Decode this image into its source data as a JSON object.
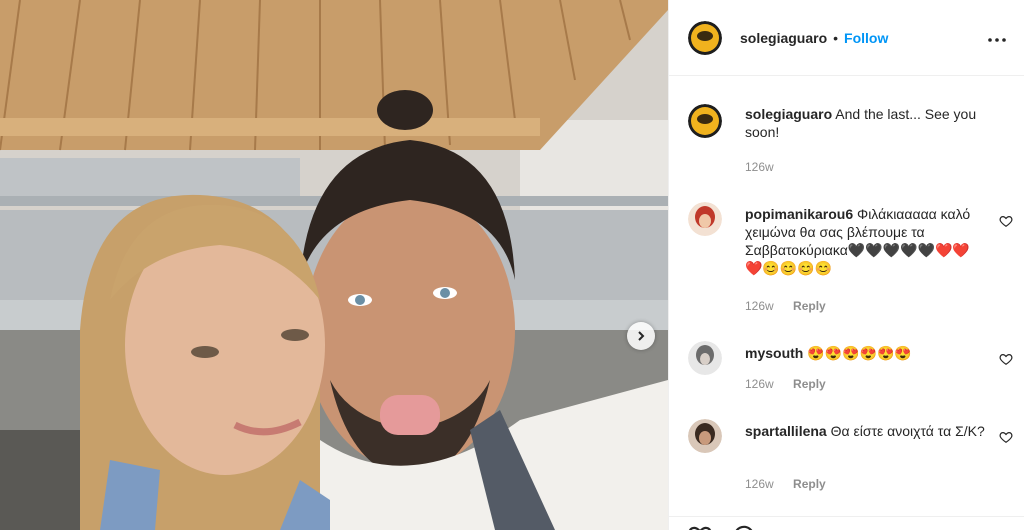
{
  "header": {
    "username": "solegiaguaro",
    "separator": "•",
    "follow_label": "Follow"
  },
  "caption": {
    "username": "solegiaguaro",
    "text": "And the last... See you soon!",
    "time": "126w"
  },
  "comments": [
    {
      "username": "popimanikarou6",
      "text": "Φιλάκιααααα καλό χειμώνα θα σας βλέπουμε τα Σαββατοκύριακα🖤🖤🖤🖤🖤❤️❤️❤️😊😊😊😊",
      "time": "126w",
      "reply_label": "Reply"
    },
    {
      "username": "mysouth",
      "text": "😍😍😍😍😍😍",
      "time": "126w",
      "reply_label": "Reply"
    },
    {
      "username": "spartallilena",
      "text": "Θα είστε ανοιχτά τα Σ/Κ?",
      "time": "126w",
      "reply_label": "Reply"
    }
  ],
  "icons": {
    "more": "more-options-icon",
    "like": "heart-icon",
    "carousel_next": "chevron-right-icon"
  },
  "colors": {
    "follow_blue": "#0095f6",
    "text": "#262626",
    "muted": "#8e8e8e",
    "border": "#efefef"
  }
}
